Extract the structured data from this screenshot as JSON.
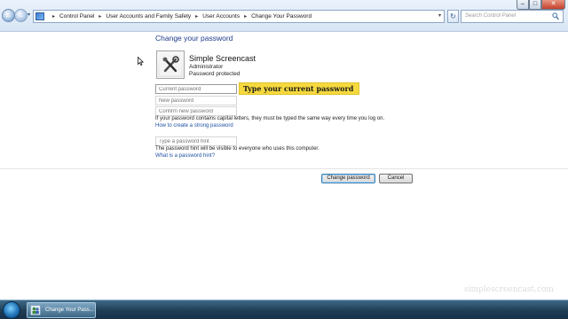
{
  "window": {
    "min_label": "–",
    "max_label": "□",
    "close_label": "✕"
  },
  "address_bar": {
    "back_label": "←",
    "forward_label": "→",
    "history_dropdown_label": "▾",
    "breadcrumb": [
      "Control Panel",
      "User Accounts and Family Safety",
      "User Accounts",
      "Change Your Password"
    ],
    "separator": "▸",
    "dropdown_label": "▾",
    "refresh_label": "↻",
    "search_placeholder": "Search Control Panel"
  },
  "page": {
    "title": "Change your password",
    "user": {
      "name": "Simple Screencast",
      "role": "Administrator",
      "status": "Password protected"
    },
    "fields": {
      "current_password": "Current password",
      "new_password": "New password",
      "confirm_password": "Confirm new password",
      "password_hint": "Type a password hint"
    },
    "callout": "Type your current password",
    "caps_note": "If your password contains capital letters, they must be typed the same way every time you log on.",
    "strong_password_link": "How to create a strong password",
    "hint_visible_note": "The password hint will be visible to everyone who uses this computer.",
    "hint_link": "What is a password hint?",
    "buttons": {
      "change_password": "Change password",
      "cancel": "Cancel"
    }
  },
  "watermark": "simplescreencast.com",
  "taskbar": {
    "item_label": "Change Your Pass..."
  },
  "colors": {
    "title_blue": "#1f3c8c",
    "link_blue": "#1e50a2",
    "callout_yellow": "#f6d93e",
    "taskbar_dark": "#1f3d55"
  },
  "icons": {
    "back": "back-arrow-icon",
    "forward": "forward-arrow-icon",
    "control_panel": "control-panel-icon",
    "refresh": "refresh-icon",
    "search": "search-icon",
    "user_picture": "user-account-picture",
    "start": "windows-start-icon",
    "cursor": "mouse-cursor-icon"
  }
}
